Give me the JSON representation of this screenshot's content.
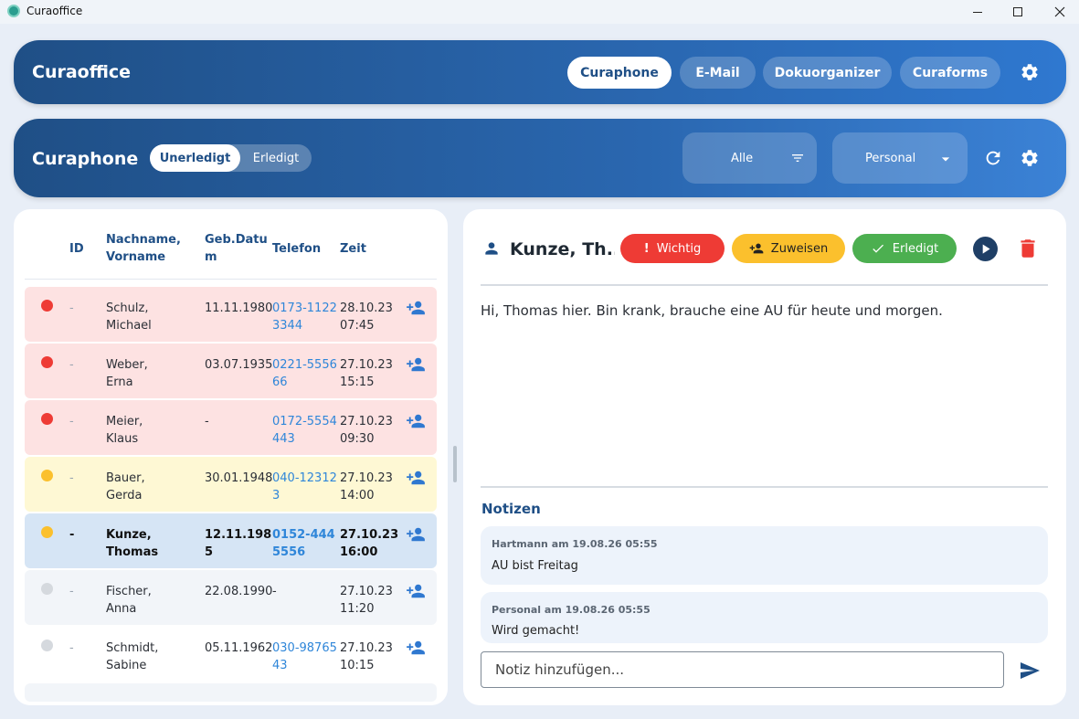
{
  "window": {
    "title": "Curaoffice"
  },
  "appbar": {
    "title": "Curaoffice",
    "nav": [
      {
        "label": "Curaphone",
        "active": true
      },
      {
        "label": "E-Mail",
        "active": false
      },
      {
        "label": "Dokuorganizer",
        "active": false
      },
      {
        "label": "Curaforms",
        "active": false
      }
    ],
    "settings_icon": "gear-icon"
  },
  "subbar": {
    "title": "Curaphone",
    "toggle": {
      "left": "Unerledigt",
      "right": "Erledigt",
      "selected": "Unerledigt"
    },
    "filter": {
      "value": "Alle",
      "icon": "filter-icon"
    },
    "personal": {
      "value": "Personal",
      "icon": "chevron-down-icon"
    },
    "refresh_icon": "refresh-icon",
    "settings_icon": "gear-icon"
  },
  "list": {
    "headers": {
      "id": "ID",
      "name_line1": "Nachname,",
      "name_line2": "Vorname",
      "dob_line1": "Geb.Datu",
      "dob_line2": "m",
      "phone": "Telefon",
      "time": "Zeit"
    },
    "rows": [
      {
        "status": "red",
        "id": "-",
        "last": "Schulz,",
        "first": "Michael",
        "dob1": "11.11.1980",
        "dob2": "",
        "phone1": "0173-1122",
        "phone2": "3344",
        "date": "28.10.23",
        "time": "07:45",
        "selected": false
      },
      {
        "status": "red",
        "id": "-",
        "last": "Weber,",
        "first": "Erna",
        "dob1": "03.07.1935",
        "dob2": "",
        "phone1": "0221-5556",
        "phone2": "66",
        "date": "27.10.23",
        "time": "15:15",
        "selected": false
      },
      {
        "status": "red",
        "id": "-",
        "last": "Meier,",
        "first": "Klaus",
        "dob1": "-",
        "dob2": "",
        "phone1": "0172-5554",
        "phone2": "443",
        "date": "27.10.23",
        "time": "09:30",
        "selected": false
      },
      {
        "status": "yellow",
        "id": "-",
        "last": "Bauer,",
        "first": "Gerda",
        "dob1": "30.01.1948",
        "dob2": "",
        "phone1": "040-12312",
        "phone2": "3",
        "date": "27.10.23",
        "time": "14:00",
        "selected": false
      },
      {
        "status": "yellow",
        "id": "-",
        "last": "Kunze,",
        "first": "Thomas",
        "dob1": "12.11.198",
        "dob2": "5",
        "phone1": "0152-444",
        "phone2": "5556",
        "date": "27.10.23",
        "time": "16:00",
        "selected": true
      },
      {
        "status": "gray",
        "id": "-",
        "last": "Fischer,",
        "first": "Anna",
        "dob1": "22.08.1990",
        "dob2": "",
        "phone1": "-",
        "phone2": "",
        "date": "27.10.23",
        "time": "11:20",
        "selected": false,
        "phone_plain": true
      },
      {
        "status": "gray",
        "id": "-",
        "last": "Schmidt,",
        "first": "Sabine",
        "dob1": "05.11.1962",
        "dob2": "",
        "phone1": "030-98765",
        "phone2": "43",
        "date": "27.10.23",
        "time": "10:15",
        "selected": false
      }
    ]
  },
  "detail": {
    "name": "Kunze, Th...",
    "buttons": {
      "important": "Wichtig",
      "assign": "Zuweisen",
      "done": "Erledigt"
    },
    "message": "Hi, Thomas hier. Bin krank, brauche eine AU für heute und morgen.",
    "notes_title": "Notizen",
    "notes": [
      {
        "meta": "Hartmann am 19.08.26 05:55",
        "text": "AU bist Freitag"
      },
      {
        "meta": "Personal am 19.08.26 05:55",
        "text": "Wird gemacht!"
      }
    ],
    "note_placeholder": "Notiz hinzufügen..."
  },
  "colors": {
    "primary": "#1f4f86",
    "accent": "#2f78d0",
    "important": "#ee3b35",
    "assign": "#fbc02d",
    "done": "#4caf50",
    "row_red": "#fde2e2",
    "row_yellow": "#fef8d4",
    "row_selected": "#d6e5f5",
    "row_gray": "#f2f5f9"
  }
}
